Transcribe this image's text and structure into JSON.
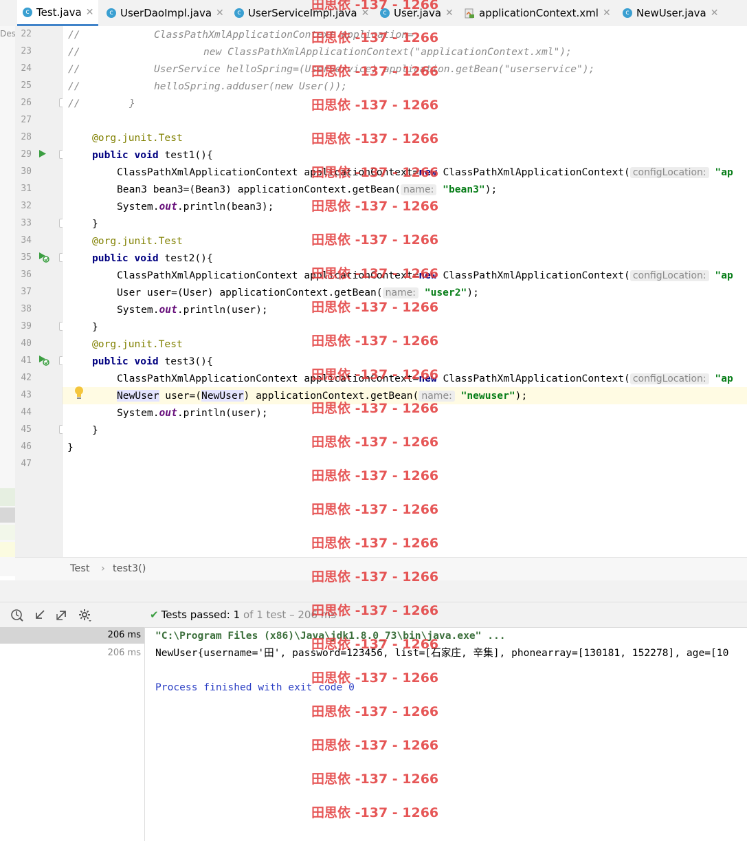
{
  "tabs": [
    {
      "label": "Test.java",
      "icon": "class-test-icon",
      "active": true
    },
    {
      "label": "UserDaoImpl.java",
      "icon": "class-icon"
    },
    {
      "label": "UserServiceImpl.java",
      "icon": "class-icon"
    },
    {
      "label": "User.java",
      "icon": "class-icon"
    },
    {
      "label": "applicationContext.xml",
      "icon": "xml-file-icon"
    },
    {
      "label": "NewUser.java",
      "icon": "class-icon"
    }
  ],
  "left_strip_label": "Des",
  "editor": {
    "line_numbers": [
      "22",
      "23",
      "24",
      "25",
      "26",
      "27",
      "28",
      "29",
      "30",
      "31",
      "32",
      "33",
      "34",
      "35",
      "36",
      "37",
      "38",
      "39",
      "40",
      "41",
      "42",
      "43",
      "44",
      "45",
      "46",
      "47"
    ],
    "lines": {
      "l22": {
        "c1": "//",
        "c2": "ClassPathXmlApplicationContext application="
      },
      "l23": {
        "c1": "//",
        "c2": "new ClassPathXmlApplicationContext(\"applicationContext.xml\");"
      },
      "l24": {
        "c1": "//",
        "c2": "UserService helloSpring=(UserService) application.getBean(\"userservice\");"
      },
      "l25": {
        "c1": "//",
        "c2": "helloSpring.adduser(new User());"
      },
      "l26": {
        "c1": "//",
        "c2": "}"
      },
      "l28": {
        "ann": "@org.junit.Test"
      },
      "l29": {
        "kw": "public void",
        "rest": " test1(){"
      },
      "l30": {
        "a": "ClassPathXmlApplicationContext applicationContext=",
        "kw": "new",
        "b": " ClassPathXmlApplicationContext(",
        "hint": "configLocation:",
        "str": "\"ap"
      },
      "l31": {
        "a": "Bean3 bean3=(Bean3) applicationContext.getBean(",
        "hint": "name:",
        "str": "\"bean3\"",
        "b": ");"
      },
      "l32": {
        "a": "System.",
        "fld": "out",
        "b": ".println(bean3);"
      },
      "l33": {
        "a": "}"
      },
      "l34": {
        "ann": "@org.junit.Test"
      },
      "l35": {
        "kw": "public void",
        "rest": " test2(){"
      },
      "l36": {
        "a": "ClassPathXmlApplicationContext applicationContext=",
        "kw": "new",
        "b": " ClassPathXmlApplicationContext(",
        "hint": "configLocation:",
        "str": "\"ap"
      },
      "l37": {
        "a": "User user=(User) applicationContext.getBean(",
        "hint": "name:",
        "str": "\"user2\"",
        "b": ");"
      },
      "l38": {
        "a": "System.",
        "fld": "out",
        "b": ".println(user);"
      },
      "l39": {
        "a": "}"
      },
      "l40": {
        "ann": "@org.junit.Test"
      },
      "l41": {
        "kw": "public void",
        "rest": " test3(){"
      },
      "l42": {
        "a": "ClassPathXmlApplicationContext applicationContext=",
        "kw": "new",
        "b": " ClassPathXmlApplicationContext(",
        "hint": "configLocation:",
        "str": "\"ap"
      },
      "l43": {
        "s1": "NewUser",
        "a": " user=(",
        "s2": "NewUser",
        "b": ") applicationContext.getBean(",
        "hint": "name:",
        "str": "\"newuser\"",
        "c": ");"
      },
      "l44": {
        "a": "System.",
        "fld": "out",
        "b": ".println(user);"
      },
      "l45": {
        "a": "}"
      },
      "l46": {
        "a": "}"
      }
    }
  },
  "breadcrumb": {
    "class": "Test",
    "sep": "›",
    "method": "test3()"
  },
  "run": {
    "status_check": "✔",
    "status_prefix": "Tests passed:",
    "passed": "1",
    "status_suffix": "of 1 test – 206 ms",
    "tree": [
      {
        "time": "206 ms"
      },
      {
        "time": "206 ms"
      }
    ],
    "console": [
      "\"C:\\Program Files (x86)\\Java\\jdk1.8.0_73\\bin\\java.exe\" ...",
      "NewUser{username='田', password=123456, list=[石家庄, 辛集], phonearray=[130181, 152278], age=[10",
      "",
      "Process finished with exit code 0"
    ]
  },
  "watermark": "田思依 -137 - 1266",
  "colors": {
    "keyword": "#000080",
    "string": "#067d17",
    "annotation": "#808000",
    "comment": "#8c8c8c",
    "pass": "#3b9e41",
    "watermark": "#e23a3a"
  }
}
